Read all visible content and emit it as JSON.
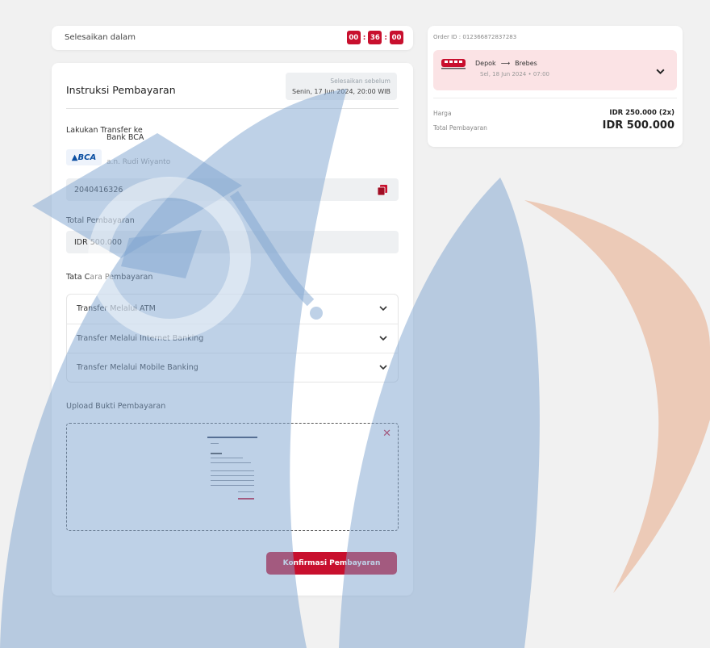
{
  "countdown": {
    "label": "Selesaikan dalam",
    "hours": "00",
    "minutes": "36",
    "seconds": "00"
  },
  "instructions": {
    "title": "Instruksi Pembayaran",
    "deadline_label": "Selesaikan sebelum",
    "deadline_value": "Senin, 17 Jun 2024, 20:00 WIB",
    "transfer_label": "Lakukan Transfer ke",
    "bank_logo": "BCA",
    "bank_name": "Bank BCA",
    "account_owner": "a.n. Rudi Wiyanto",
    "account_number": "2040416326",
    "total_label": "Total Pembayaran",
    "total_value": "IDR 500.000",
    "howto_label": "Tata Cara Pembayaran",
    "methods": [
      "Transfer Melalui ATM",
      "Transfer Melalui Internet Banking",
      "Transfer Melalui Mobile Banking"
    ],
    "upload_label": "Upload Bukti Pembayaran",
    "confirm_label": "Konfirmasi Pembayaran"
  },
  "order": {
    "order_id": "Order ID : 012366872837283",
    "origin": "Depok",
    "destination": "Brebes",
    "trip_date": "Sel, 18 Jun 2024  •  07:00",
    "price_label": "Harga",
    "price_value": "IDR 250.000 (2x)",
    "total_label": "Total Pembayaran",
    "total_value": "IDR 500.000"
  },
  "colors": {
    "accent": "#c8102e",
    "trip_bg": "#fbe3e5",
    "watermark_blue": "#7ea3cf",
    "watermark_orange": "#e8a37d"
  }
}
